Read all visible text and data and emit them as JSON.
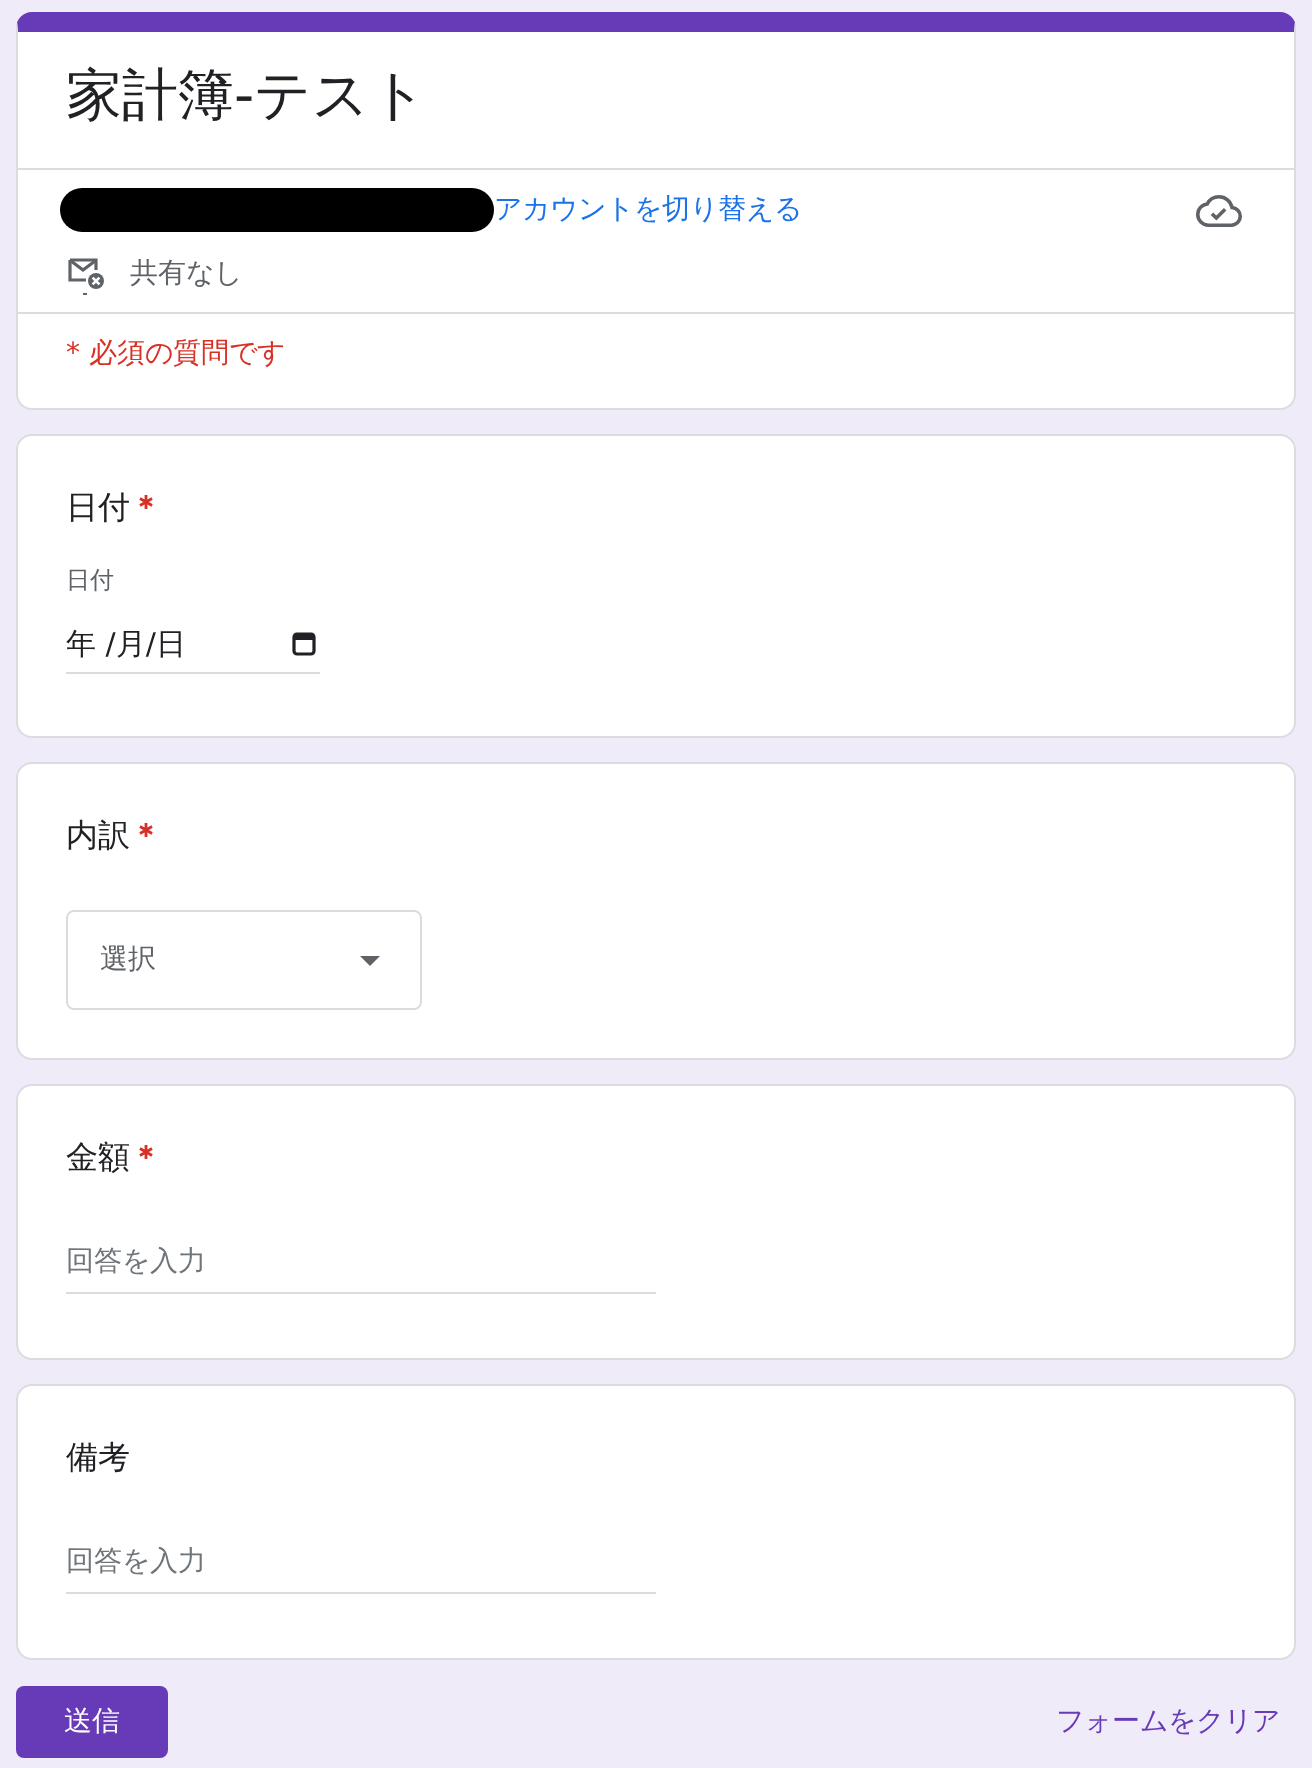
{
  "header": {
    "title": "家計簿-テスト",
    "account": {
      "switch_link": "アカウントを切り替える"
    },
    "sharing": "共有なし",
    "required_note": "* 必須の質問です"
  },
  "questions": [
    {
      "kind": "date",
      "title": "日付",
      "required": true,
      "sublabel": "日付",
      "placeholder": "年 /月/日"
    },
    {
      "kind": "dropdown",
      "title": "内訳",
      "required": true,
      "placeholder": "選択"
    },
    {
      "kind": "text",
      "title": "金額",
      "required": true,
      "placeholder": "回答を入力"
    },
    {
      "kind": "text",
      "title": "備考",
      "required": false,
      "placeholder": "回答を入力"
    }
  ],
  "footer": {
    "submit": "送信",
    "clear": "フォームをクリア"
  }
}
